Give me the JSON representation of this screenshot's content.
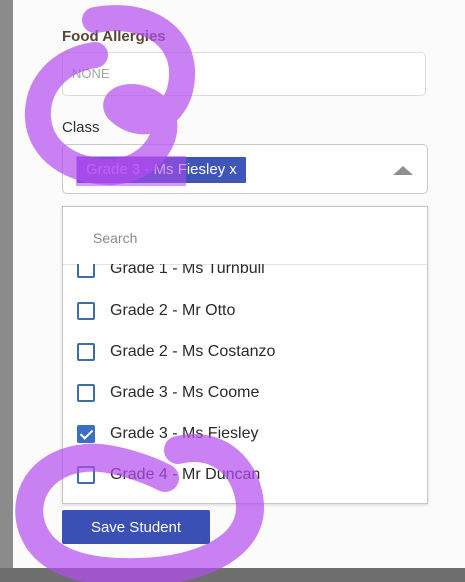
{
  "form": {
    "food_allergies_label": "Food Allergies",
    "food_allergies_value": "NONE",
    "class_label": "Class",
    "selected_chip": {
      "label": "Grade 3 - Ms Fiesley",
      "remove": "x"
    },
    "search_placeholder": "Search",
    "options": [
      {
        "label": "Grade 1 - Ms Turnbull",
        "checked": false
      },
      {
        "label": "Grade 2 - Mr Otto",
        "checked": false
      },
      {
        "label": "Grade 2 - Ms Costanzo",
        "checked": false
      },
      {
        "label": "Grade 3 - Ms Coome",
        "checked": false
      },
      {
        "label": "Grade 3 - Ms Fiesley",
        "checked": true
      },
      {
        "label": "Grade 4 - Mr Duncan",
        "checked": false
      }
    ],
    "save_label": "Save Student"
  },
  "colors": {
    "accent": "#3a50b4",
    "marker": "#b44bf0",
    "checkbox": "#3f6ea6"
  },
  "icons": {
    "caret": "caret-up-icon",
    "check": "checkmark-icon"
  }
}
